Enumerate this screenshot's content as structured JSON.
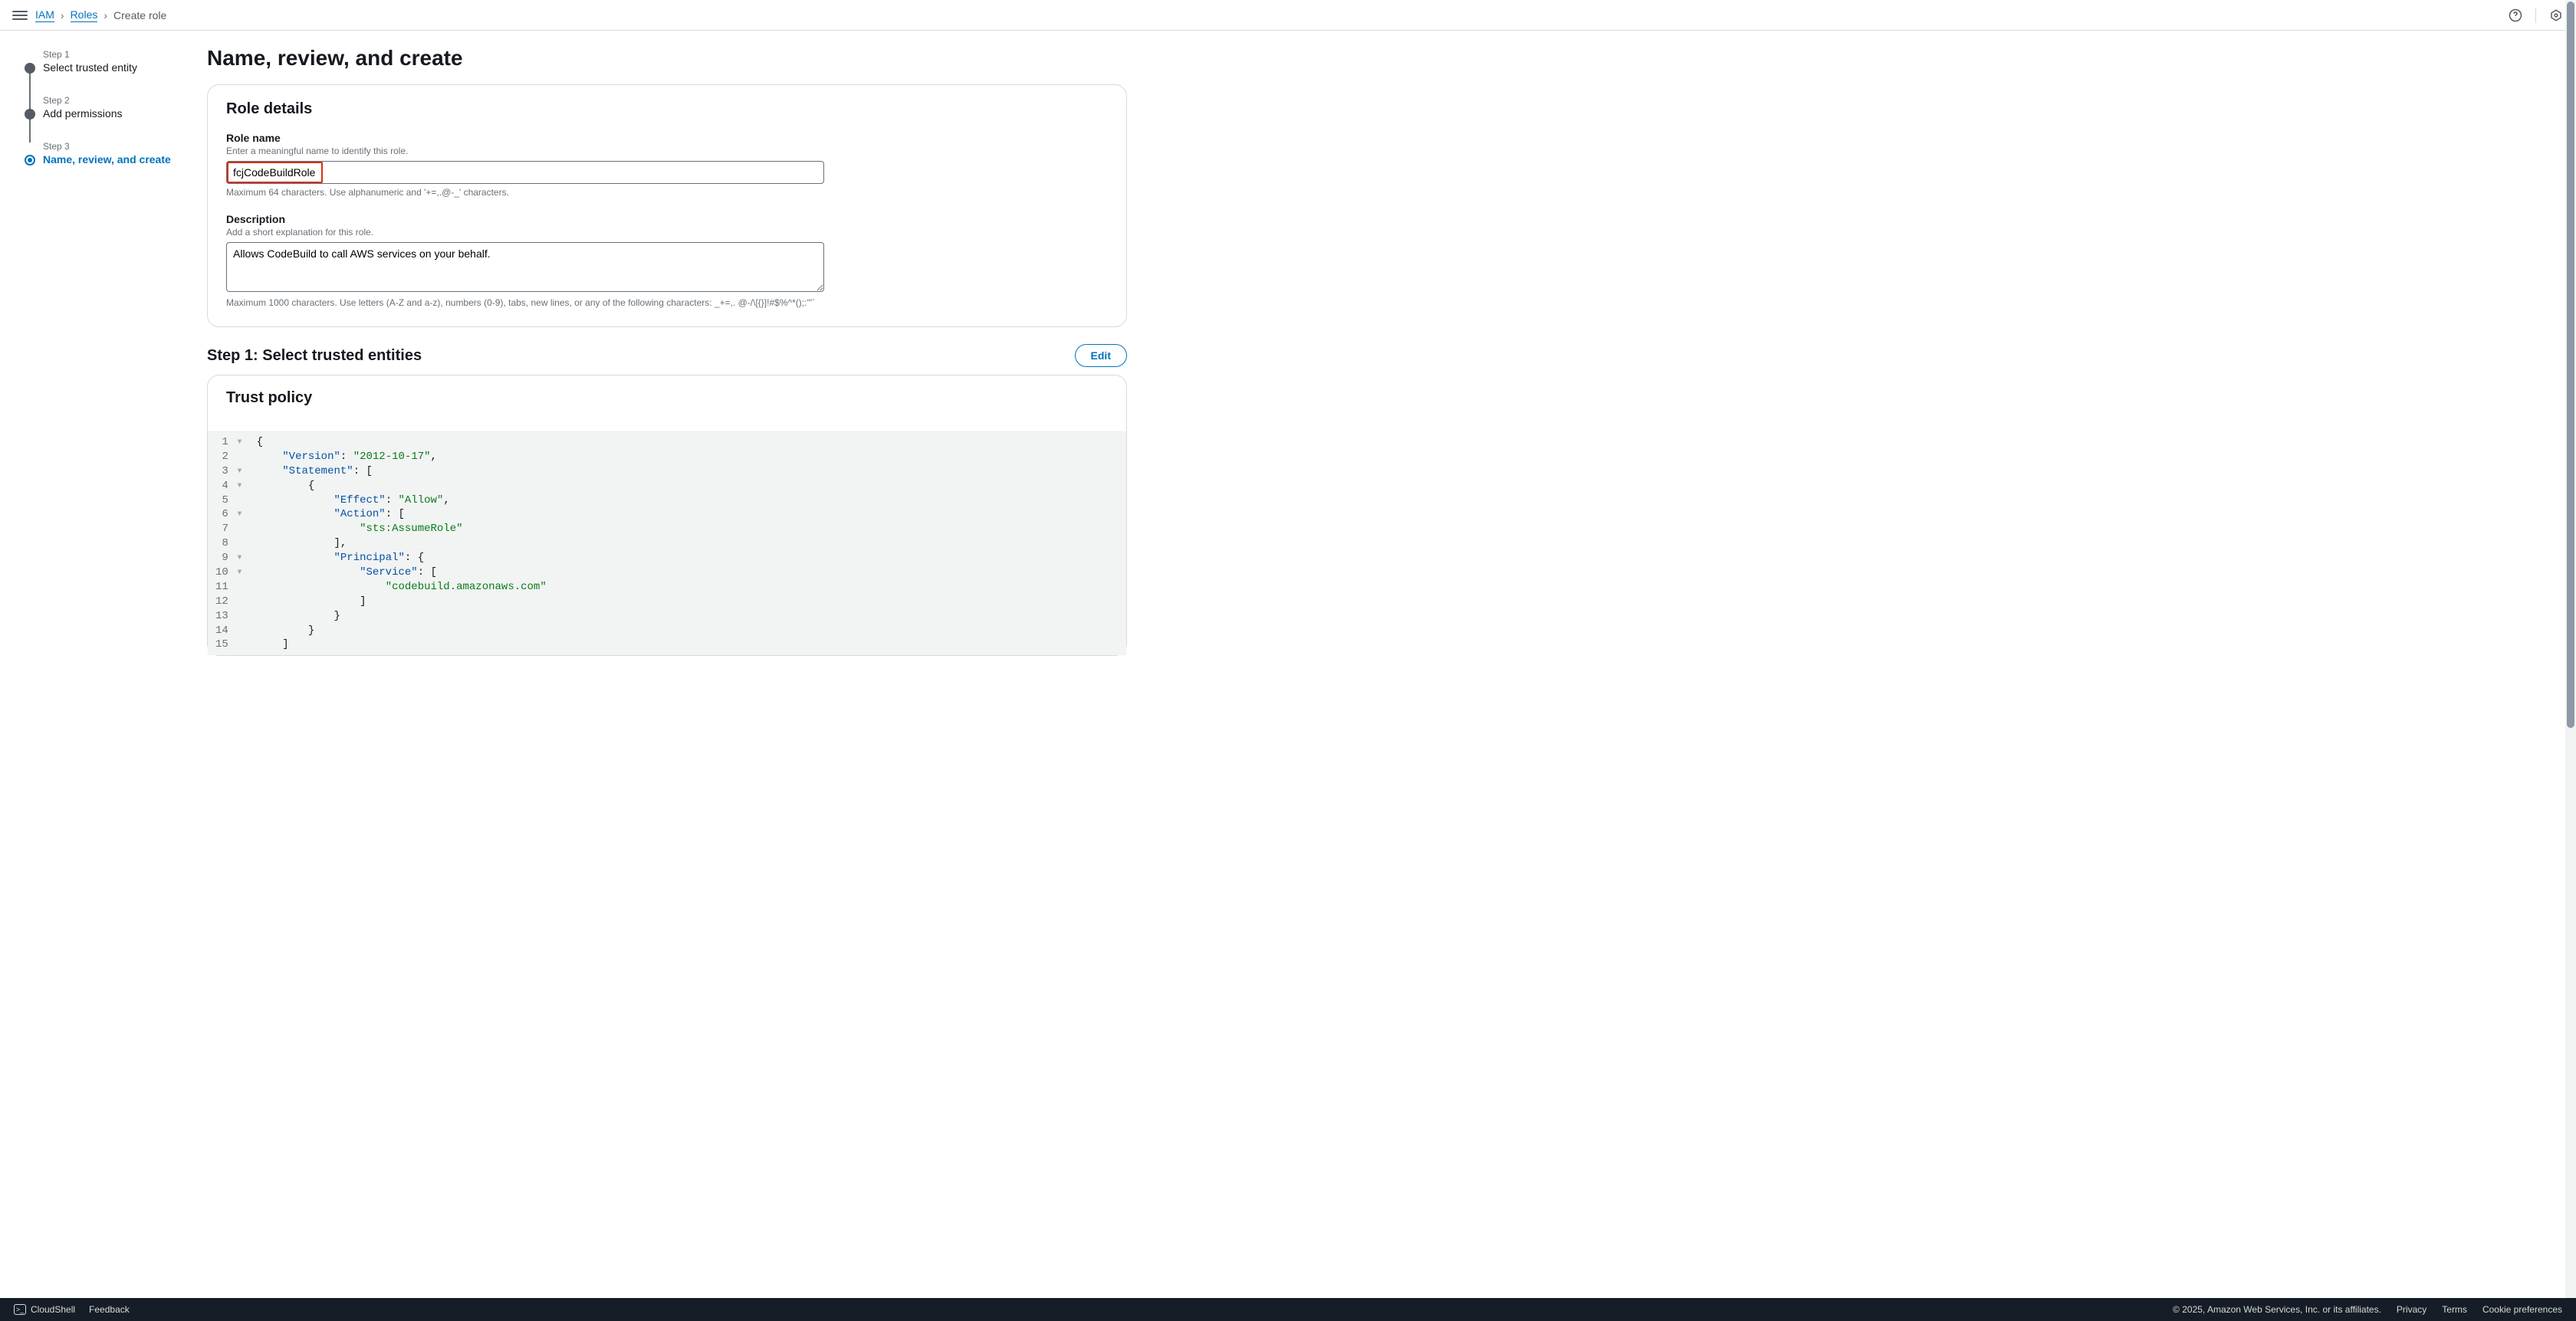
{
  "breadcrumb": {
    "service": "IAM",
    "section": "Roles",
    "current": "Create role"
  },
  "stepper": {
    "step1_num": "Step 1",
    "step1_label": "Select trusted entity",
    "step2_num": "Step 2",
    "step2_label": "Add permissions",
    "step3_num": "Step 3",
    "step3_label": "Name, review, and create"
  },
  "page_title": "Name, review, and create",
  "role_details": {
    "panel_title": "Role details",
    "name_label": "Role name",
    "name_desc": "Enter a meaningful name to identify this role.",
    "name_value": "fcjCodeBuildRole",
    "name_constraints": "Maximum 64 characters. Use alphanumeric and '+=,.@-_' characters.",
    "desc_label": "Description",
    "desc_desc": "Add a short explanation for this role.",
    "desc_value": "Allows CodeBuild to call AWS services on your behalf.",
    "desc_constraints": "Maximum 1000 characters. Use letters (A-Z and a-z), numbers (0-9), tabs, new lines, or any of the following characters: _+=,. @-/\\[{}]!#$%^*();:'\"`"
  },
  "step1_section": {
    "title": "Step 1: Select trusted entities",
    "edit_label": "Edit"
  },
  "trust_policy": {
    "panel_title": "Trust policy",
    "lines": {
      "n1": "1",
      "l1": "{",
      "n2": "2",
      "l2_k": "\"Version\"",
      "l2_v": "\"2012-10-17\"",
      "n3": "3",
      "l3_k": "\"Statement\"",
      "n4": "4",
      "n5": "5",
      "l5_k": "\"Effect\"",
      "l5_v": "\"Allow\"",
      "n6": "6",
      "l6_k": "\"Action\"",
      "n7": "7",
      "l7_v": "\"sts:AssumeRole\"",
      "n8": "8",
      "n9": "9",
      "l9_k": "\"Principal\"",
      "n10": "10",
      "l10_k": "\"Service\"",
      "n11": "11",
      "l11_v": "\"codebuild.amazonaws.com\"",
      "n12": "12",
      "n13": "13",
      "n14": "14",
      "n15": "15"
    }
  },
  "footer": {
    "cloudshell": "CloudShell",
    "feedback": "Feedback",
    "copyright": "© 2025, Amazon Web Services, Inc. or its affiliates.",
    "privacy": "Privacy",
    "terms": "Terms",
    "cookies": "Cookie preferences"
  }
}
